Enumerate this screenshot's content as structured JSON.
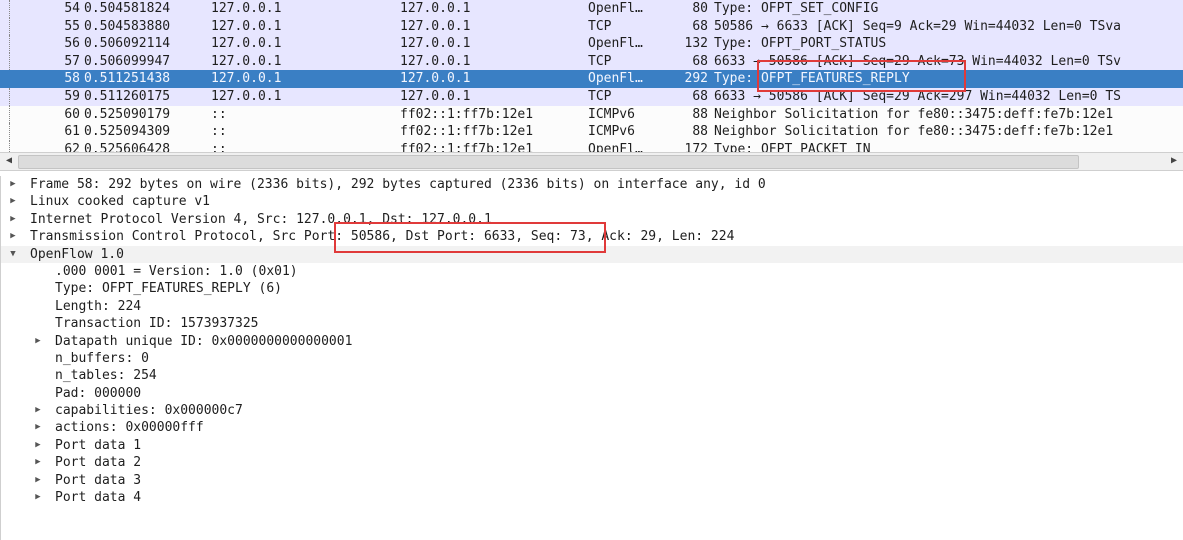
{
  "packets": [
    {
      "no": "54",
      "time": "0.504581824",
      "src": "127.0.0.1",
      "dst": "127.0.0.1",
      "proto": "OpenFl…",
      "len": "80",
      "info": "Type: OFPT_SET_CONFIG",
      "kind": "openflow"
    },
    {
      "no": "55",
      "time": "0.504583880",
      "src": "127.0.0.1",
      "dst": "127.0.0.1",
      "proto": "TCP",
      "len": "68",
      "info": "50586 → 6633 [ACK] Seq=9 Ack=29 Win=44032 Len=0 TSva",
      "kind": "tcp"
    },
    {
      "no": "56",
      "time": "0.506092114",
      "src": "127.0.0.1",
      "dst": "127.0.0.1",
      "proto": "OpenFl…",
      "len": "132",
      "info": "Type: OFPT_PORT_STATUS",
      "kind": "openflow"
    },
    {
      "no": "57",
      "time": "0.506099947",
      "src": "127.0.0.1",
      "dst": "127.0.0.1",
      "proto": "TCP",
      "len": "68",
      "info": "6633 → 50586 [ACK] Seq=29 Ack=73 Win=44032 Len=0 TSv",
      "kind": "tcp"
    },
    {
      "no": "58",
      "time": "0.511251438",
      "src": "127.0.0.1",
      "dst": "127.0.0.1",
      "proto": "OpenFl…",
      "len": "292",
      "info": "Type: OFPT_FEATURES_REPLY",
      "kind": "selected"
    },
    {
      "no": "59",
      "time": "0.511260175",
      "src": "127.0.0.1",
      "dst": "127.0.0.1",
      "proto": "TCP",
      "len": "68",
      "info": "6633 → 50586 [ACK] Seq=29 Ack=297 Win=44032 Len=0 TS",
      "kind": "tcp"
    },
    {
      "no": "60",
      "time": "0.525090179",
      "src": "::",
      "dst": "ff02::1:ff7b:12e1",
      "proto": "ICMPv6",
      "len": "88",
      "info": "Neighbor Solicitation for fe80::3475:deff:fe7b:12e1",
      "kind": "icmp"
    },
    {
      "no": "61",
      "time": "0.525094309",
      "src": "::",
      "dst": "ff02::1:ff7b:12e1",
      "proto": "ICMPv6",
      "len": "88",
      "info": "Neighbor Solicitation for fe80::3475:deff:fe7b:12e1",
      "kind": "icmp"
    },
    {
      "no": "62",
      "time": "0.525606428",
      "src": "::",
      "dst": "ff02::1:ff7b:12e1",
      "proto": "OpenFl…",
      "len": "172",
      "info": "Type: OFPT_PACKET_IN",
      "kind": "icmp"
    }
  ],
  "details": [
    {
      "text": "Frame 58: 292 bytes on wire (2336 bits), 292 bytes captured (2336 bits) on interface any, id 0",
      "indent": 0,
      "expander": "closed"
    },
    {
      "text": "Linux cooked capture v1",
      "indent": 0,
      "expander": "closed"
    },
    {
      "text": "Internet Protocol Version 4, Src: 127.0.0.1, Dst: 127.0.0.1",
      "indent": 0,
      "expander": "closed"
    },
    {
      "text": "Transmission Control Protocol, Src Port: 50586, Dst Port: 6633, Seq: 73, Ack: 29, Len: 224",
      "indent": 0,
      "expander": "closed"
    },
    {
      "text": "OpenFlow 1.0",
      "indent": 0,
      "expander": "open"
    },
    {
      "text": ".000 0001 = Version: 1.0 (0x01)",
      "indent": 1,
      "expander": "none"
    },
    {
      "text": "Type: OFPT_FEATURES_REPLY (6)",
      "indent": 1,
      "expander": "none"
    },
    {
      "text": "Length: 224",
      "indent": 1,
      "expander": "none"
    },
    {
      "text": "Transaction ID: 1573937325",
      "indent": 1,
      "expander": "none"
    },
    {
      "text": "Datapath unique ID: 0x0000000000000001",
      "indent": 1,
      "expander": "closed"
    },
    {
      "text": "n_buffers: 0",
      "indent": 1,
      "expander": "none"
    },
    {
      "text": "n_tables: 254",
      "indent": 1,
      "expander": "none"
    },
    {
      "text": "Pad: 000000",
      "indent": 1,
      "expander": "none"
    },
    {
      "text": "capabilities: 0x000000c7",
      "indent": 1,
      "expander": "closed"
    },
    {
      "text": "actions: 0x00000fff",
      "indent": 1,
      "expander": "closed"
    },
    {
      "text": "Port data 1",
      "indent": 1,
      "expander": "closed"
    },
    {
      "text": "Port data 2",
      "indent": 1,
      "expander": "closed"
    },
    {
      "text": "Port data 3",
      "indent": 1,
      "expander": "closed"
    },
    {
      "text": "Port data 4",
      "indent": 1,
      "expander": "closed"
    }
  ],
  "icons": {
    "expand_closed": "triangle-right-icon",
    "expand_open": "triangle-down-icon",
    "scroll_left": "scroll-left-icon",
    "scroll_right": "scroll-right-icon"
  },
  "colors": {
    "selected_row": "#3a7fc4",
    "openflow_row": "#e7e6ff",
    "highlight_box": "#e03a3a"
  }
}
